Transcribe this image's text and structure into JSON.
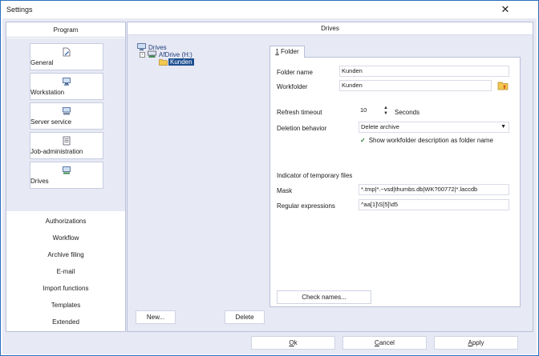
{
  "window": {
    "title": "Settings",
    "close_glyph": "✕"
  },
  "left": {
    "header": "Program",
    "nav": [
      {
        "label": "General",
        "icon": "edit-document-icon"
      },
      {
        "label": "Workstation",
        "icon": "monitor-icon"
      },
      {
        "label": "Server service",
        "icon": "server-icon"
      },
      {
        "label": "Job-administration",
        "icon": "document-list-icon"
      },
      {
        "label": "Drives",
        "icon": "drive-icon"
      }
    ],
    "lower": [
      "Authorizations",
      "Workflow",
      "Archive filing",
      "E-mail",
      "Import functions",
      "Templates",
      "Extended"
    ]
  },
  "right": {
    "header": "Drives",
    "tree": {
      "root": "Drives",
      "drive": "AfDrive (H:)",
      "folder": "Kunden",
      "expander": "-"
    },
    "tab": {
      "num": "1",
      "label": " Folder"
    },
    "form": {
      "folder_name_label": "Folder name",
      "folder_name_value": "Kunden",
      "workfolder_label": "Workfolder",
      "workfolder_value": "Kunden",
      "refresh_label": "Refresh timeout",
      "refresh_value": "10",
      "refresh_unit": "Seconds",
      "spin_up": "▲",
      "spin_down": "▼",
      "deletion_label": "Deletion behavior",
      "deletion_value": "Delete archive",
      "dropdown_glyph": "▼",
      "checkmark": "✓",
      "show_desc_label": "Show workfolder description as folder name",
      "show_desc_checked": true,
      "temp_header": "Indicator of temporary files",
      "mask_label": "Mask",
      "mask_value": "*.tmp|*.~vsd|thumbs.db|WK?00772|*.laccdb",
      "regex_label": "Regular expressions",
      "regex_value": "^aa[1]\\S[5]\\d5",
      "check_names": "Check names..."
    },
    "new_button": "New...",
    "delete_button": "Delete"
  },
  "footer": {
    "ok_key": "O",
    "ok_rest": "k",
    "cancel_key": "C",
    "cancel_rest": "ancel",
    "apply_key": "A",
    "apply_rest": "pply"
  }
}
